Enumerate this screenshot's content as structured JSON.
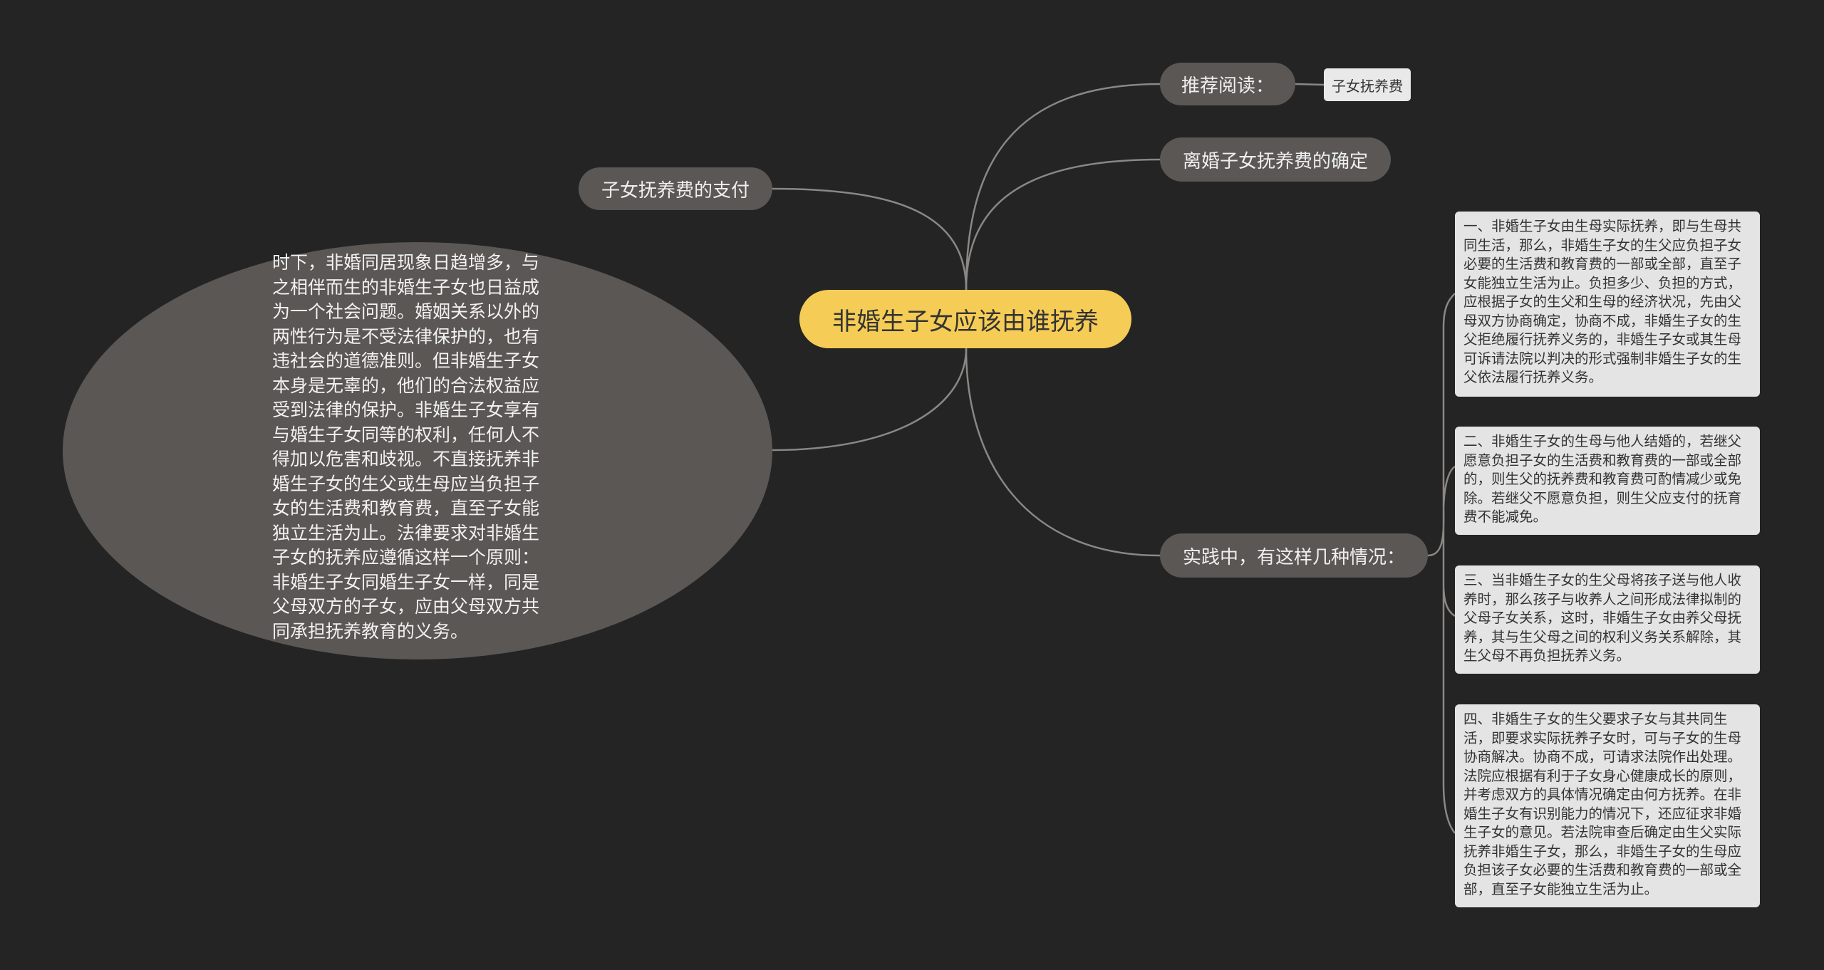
{
  "root": {
    "label": "非婚生子女应该由谁抚养"
  },
  "left": {
    "topic": "子女抚养费的支付",
    "detail": "时下，非婚同居现象日趋增多，与之相伴而生的非婚生子女也日益成为一个社会问题。婚姻关系以外的两性行为是不受法律保护的，也有违社会的道德准则。但非婚生子女本身是无辜的，他们的合法权益应受到法律的保护。非婚生子女享有与婚生子女同等的权利，任何人不得加以危害和歧视。不直接抚养非婚生子女的生父或生母应当负担子女的生活费和教育费，直至子女能独立生活为止。法律要求对非婚生子女的抚养应遵循这样一个原则：非婚生子女同婚生子女一样，同是父母双方的子女，应由父母双方共同承担抚养教育的义务。"
  },
  "right": {
    "recommend": {
      "label": "推荐阅读：",
      "tag": "子女抚养费"
    },
    "divorce": {
      "label": "离婚子女抚养费的确定"
    },
    "practice": {
      "label": "实践中，有这样几种情况：",
      "cards": [
        "一、非婚生子女由生母实际抚养，即与生母共同生活，那么，非婚生子女的生父应负担子女必要的生活费和教育费的一部或全部，直至子女能独立生活为止。负担多少、负担的方式，应根据子女的生父和生母的经济状况，先由父母双方协商确定，协商不成，非婚生子女的生父拒绝履行抚养义务的，非婚生子女或其生母可诉请法院以判决的形式强制非婚生子女的生父依法履行抚养义务。",
        "二、非婚生子女的生母与他人结婚的，若继父愿意负担子女的生活费和教育费的一部或全部的，则生父的抚养费和教育费可酌情减少或免除。若继父不愿意负担，则生父应支付的抚育费不能减免。",
        "三、当非婚生子女的生父母将孩子送与他人收养时，那么孩子与收养人之间形成法律拟制的父母子女关系，这时，非婚生子女由养父母抚养，其与生父母之间的权利义务关系解除，其生父母不再负担抚养义务。",
        "四、非婚生子女的生父要求子女与其共同生活，即要求实际抚养子女时，可与子女的生母协商解决。协商不成，可请求法院作出处理。法院应根据有利于子女身心健康成长的原则，并考虑双方的具体情况确定由何方抚养。在非婚生子女有识别能力的情况下，还应征求非婚生子女的意见。若法院审查后确定由生父实际抚养非婚生子女，那么，非婚生子女的生母应负担该子女必要的生活费和教育费的一部或全部，直至子女能独立生活为止。"
      ]
    }
  },
  "colors": {
    "background": "#242424",
    "root": "#f5cc55",
    "topic": "#5a5754",
    "card": "#e4e4e4",
    "line": "#8a8784"
  }
}
